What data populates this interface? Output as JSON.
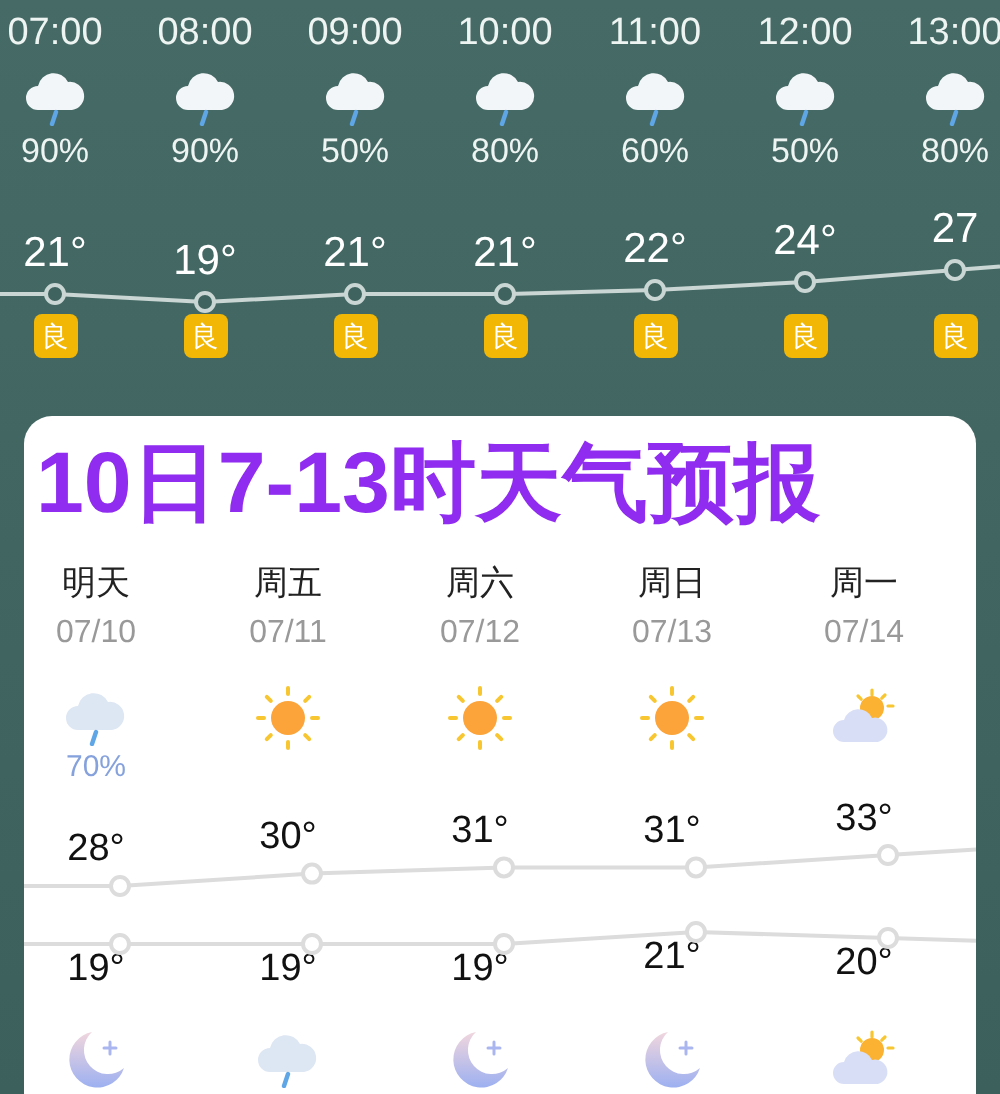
{
  "hourly": [
    {
      "time": "07:00",
      "kind": "rain",
      "precip": "90%",
      "temp": "21°",
      "air_quality": "良"
    },
    {
      "time": "08:00",
      "kind": "rain",
      "precip": "90%",
      "temp": "19°",
      "air_quality": "良"
    },
    {
      "time": "09:00",
      "kind": "rain",
      "precip": "50%",
      "temp": "21°",
      "air_quality": "良"
    },
    {
      "time": "10:00",
      "kind": "rain",
      "precip": "80%",
      "temp": "21°",
      "air_quality": "良"
    },
    {
      "time": "11:00",
      "kind": "rain",
      "precip": "60%",
      "temp": "22°",
      "air_quality": "良"
    },
    {
      "time": "12:00",
      "kind": "rain",
      "precip": "50%",
      "temp": "24°",
      "air_quality": "良"
    },
    {
      "time": "13:00",
      "kind": "rain",
      "precip": "80%",
      "temp": "27",
      "air_quality": "良"
    }
  ],
  "forecast": {
    "title": "10日7-13时天气预报",
    "days": [
      {
        "day": "明天",
        "date": "07/10",
        "daytime": {
          "kind": "rain",
          "precip": "70%"
        },
        "high": "28°",
        "low": "19°",
        "night": {
          "kind": "night"
        }
      },
      {
        "day": "周五",
        "date": "07/11",
        "daytime": {
          "kind": "sunny"
        },
        "high": "30°",
        "low": "19°",
        "night": {
          "kind": "rain"
        }
      },
      {
        "day": "周六",
        "date": "07/12",
        "daytime": {
          "kind": "sunny"
        },
        "high": "31°",
        "low": "19°",
        "night": {
          "kind": "night"
        }
      },
      {
        "day": "周日",
        "date": "07/13",
        "daytime": {
          "kind": "sunny"
        },
        "high": "31°",
        "low": "21°",
        "night": {
          "kind": "night"
        }
      },
      {
        "day": "周一",
        "date": "07/14",
        "daytime": {
          "kind": "cloudy"
        },
        "high": "33°",
        "low": "20°",
        "night": {
          "kind": "cloudy"
        }
      }
    ]
  }
}
